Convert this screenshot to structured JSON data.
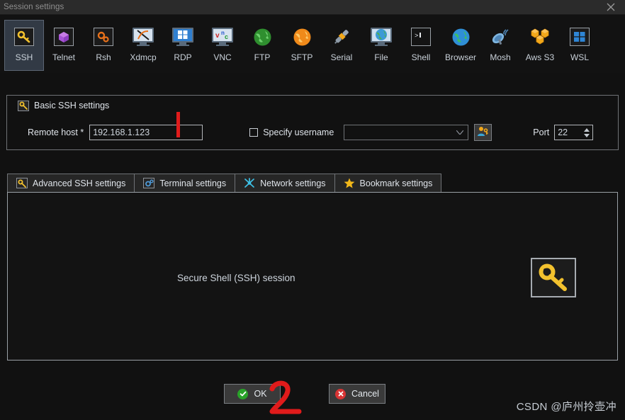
{
  "window": {
    "title": "Session settings",
    "close_icon": "close-icon"
  },
  "protocols": [
    {
      "label": "SSH",
      "icon": "key-icon",
      "selected": true
    },
    {
      "label": "Telnet",
      "icon": "cube-icon",
      "selected": false
    },
    {
      "label": "Rsh",
      "icon": "gears-icon",
      "selected": false
    },
    {
      "label": "Xdmcp",
      "icon": "x-monitor-icon",
      "selected": false
    },
    {
      "label": "RDP",
      "icon": "windows-monitor-icon",
      "selected": false
    },
    {
      "label": "VNC",
      "icon": "vnc-monitor-icon",
      "selected": false
    },
    {
      "label": "FTP",
      "icon": "green-globe-icon",
      "selected": false
    },
    {
      "label": "SFTP",
      "icon": "orange-globe-icon",
      "selected": false
    },
    {
      "label": "Serial",
      "icon": "serial-plug-icon",
      "selected": false
    },
    {
      "label": "File",
      "icon": "file-monitor-icon",
      "selected": false
    },
    {
      "label": "Shell",
      "icon": "terminal-prompt-icon",
      "selected": false
    },
    {
      "label": "Browser",
      "icon": "blue-globe-icon",
      "selected": false
    },
    {
      "label": "Mosh",
      "icon": "satellite-dish-icon",
      "selected": false
    },
    {
      "label": "Aws S3",
      "icon": "aws-cubes-icon",
      "selected": false
    },
    {
      "label": "WSL",
      "icon": "windows-logo-icon",
      "selected": false
    }
  ],
  "basic_group": {
    "legend": "Basic SSH settings",
    "legend_icon": "key-icon",
    "remote_host_label": "Remote host *",
    "remote_host_value": "192.168.1.123",
    "remote_host_placeholder": "",
    "specify_username_label": "Specify username",
    "specify_username_checked": false,
    "username_value": "",
    "username_placeholder": "",
    "username_dropdown_icon": "chevron-down-icon",
    "user_key_button_icon": "user-key-icon",
    "port_label": "Port",
    "port_value": "22",
    "port_spinner_icon": "spinner-arrows-icon"
  },
  "tabs": [
    {
      "label": "Advanced SSH settings",
      "icon": "key-icon",
      "active": false
    },
    {
      "label": "Terminal settings",
      "icon": "terminal-gear-icon",
      "active": false
    },
    {
      "label": "Network settings",
      "icon": "network-node-icon",
      "active": false
    },
    {
      "label": "Bookmark settings",
      "icon": "star-icon",
      "active": false
    }
  ],
  "content": {
    "description": "Secure Shell (SSH) session",
    "panel_icon": "key-icon"
  },
  "buttons": {
    "ok_label": "OK",
    "ok_icon": "check-circle-icon",
    "cancel_label": "Cancel",
    "cancel_icon": "x-circle-icon"
  },
  "annotations": [
    {
      "name": "annotation-1",
      "text": "1",
      "color": "#e01b1b"
    },
    {
      "name": "annotation-2",
      "text": "2",
      "color": "#e01b1b"
    }
  ],
  "watermark": "CSDN @庐州拎壶冲",
  "colors": {
    "background": "#111111",
    "titlebar": "#2b2b2b",
    "selected_item": "#323a45",
    "accent_orange": "#f2b33d",
    "annotation_red": "#e01b1b",
    "ok_green": "#29a329",
    "cancel_red": "#d83434"
  }
}
